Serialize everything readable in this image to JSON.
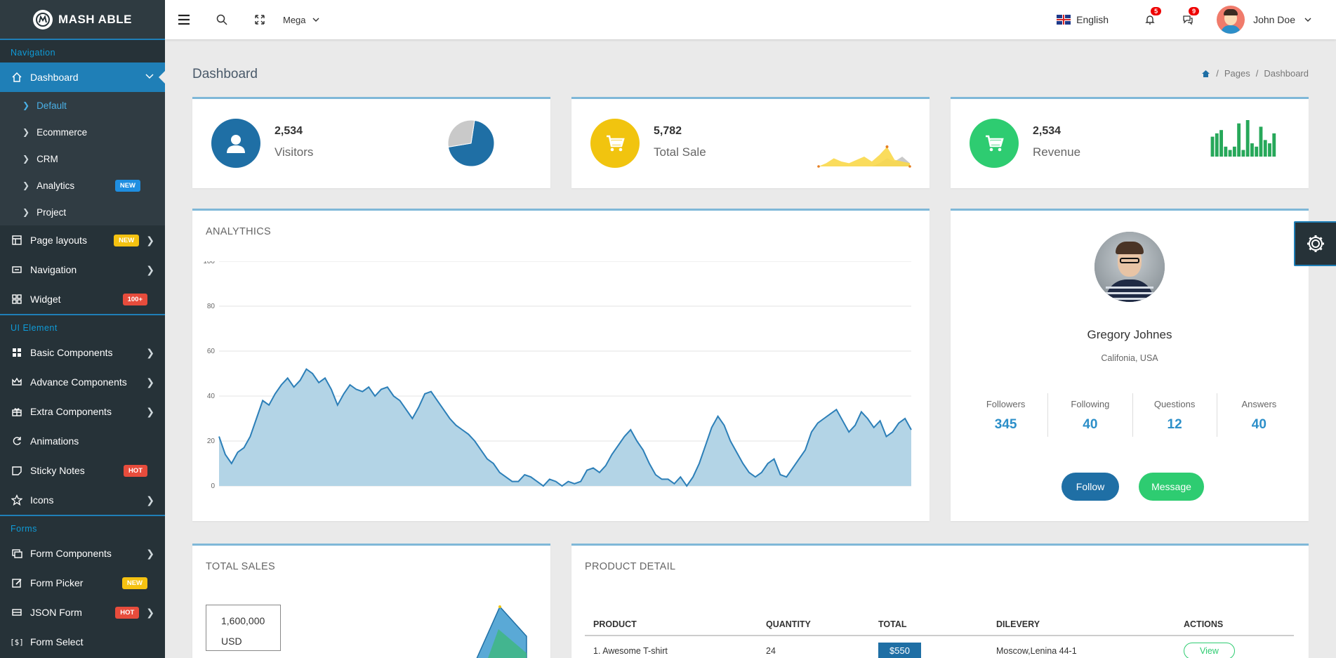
{
  "brand": {
    "name": "MASH ABLE"
  },
  "sidebar": {
    "captions": {
      "navigation": "Navigation",
      "ui": "UI Element",
      "forms": "Forms"
    },
    "dashboard": {
      "label": "Dashboard",
      "children": [
        "Default",
        "Ecommerce",
        "CRM",
        "Analytics",
        "Project"
      ],
      "analytics_badge": "NEW"
    },
    "items_nav": [
      {
        "label": "Page layouts",
        "badge": "NEW",
        "badge_color": "yellow",
        "icon": "layout-icon"
      },
      {
        "label": "Navigation",
        "badge": "",
        "icon": "navigation-icon"
      },
      {
        "label": "Widget",
        "badge": "100+",
        "badge_color": "red",
        "icon": "widget-icon"
      }
    ],
    "items_ui": [
      {
        "label": "Basic Components",
        "icon": "grid-icon"
      },
      {
        "label": "Advance Components",
        "icon": "crown-icon"
      },
      {
        "label": "Extra Components",
        "icon": "gift-icon"
      },
      {
        "label": "Animations",
        "icon": "refresh-icon"
      },
      {
        "label": "Sticky Notes",
        "badge": "HOT",
        "icon": "sticky-note-icon"
      },
      {
        "label": "Icons",
        "icon": "star-icon"
      }
    ],
    "items_forms": [
      {
        "label": "Form Components",
        "icon": "form-icon"
      },
      {
        "label": "Form Picker",
        "badge": "NEW",
        "icon": "edit-icon"
      },
      {
        "label": "JSON Form",
        "badge": "HOT",
        "icon": "json-icon"
      },
      {
        "label": "Form Select",
        "icon": "select-icon"
      }
    ]
  },
  "header": {
    "mega_label": "Mega",
    "language": "English",
    "notif_count": "5",
    "chat_count": "9",
    "user_name": "John Doe"
  },
  "page": {
    "title": "Dashboard",
    "breadcrumb": [
      "Pages",
      "Dashboard"
    ]
  },
  "stats": [
    {
      "value": "2,534",
      "label": "Visitors",
      "color": "#1f6fa5"
    },
    {
      "value": "5,782",
      "label": "Total Sale",
      "color": "#f1c40f"
    },
    {
      "value": "2,534",
      "label": "Revenue",
      "color": "#2ecc71"
    }
  ],
  "analytics": {
    "title": "ANALYTHICS"
  },
  "chart_data": {
    "type": "area",
    "title": "ANALYTHICS",
    "ylim": [
      0,
      100
    ],
    "yticks": [
      0,
      20,
      40,
      60,
      80,
      100
    ],
    "grid": true,
    "color": "#2c7fb8",
    "values": [
      22,
      14,
      10,
      15,
      17,
      22,
      30,
      38,
      36,
      41,
      45,
      48,
      44,
      47,
      52,
      50,
      46,
      48,
      43,
      36,
      41,
      45,
      43,
      42,
      44,
      40,
      43,
      44,
      40,
      38,
      34,
      30,
      35,
      41,
      42,
      38,
      34,
      30,
      27,
      25,
      23,
      20,
      16,
      12,
      10,
      6,
      4,
      2,
      2,
      5,
      4,
      2,
      0,
      3,
      2,
      0,
      2,
      1,
      2,
      7,
      8,
      6,
      9,
      14,
      18,
      22,
      25,
      20,
      16,
      10,
      5,
      3,
      3,
      1,
      4,
      0,
      4,
      10,
      18,
      26,
      31,
      27,
      20,
      15,
      10,
      6,
      4,
      6,
      10,
      12,
      5,
      4,
      8,
      12,
      16,
      24,
      28,
      30,
      32,
      34,
      29,
      24,
      27,
      33,
      30,
      26,
      29,
      22,
      24,
      28,
      30,
      25
    ]
  },
  "sparklines": {
    "visitors_pie": [
      70,
      30
    ],
    "sales_area": [
      [
        0,
        2,
        5,
        3,
        2,
        4,
        6,
        3,
        7,
        12,
        4,
        3,
        2
      ],
      [
        0,
        0,
        0,
        0,
        0,
        0,
        0,
        0,
        2,
        5,
        3,
        6,
        2
      ]
    ],
    "revenue_bars": [
      6,
      7,
      8,
      3,
      2,
      3,
      10,
      2,
      11,
      4,
      3,
      9,
      5,
      4,
      7
    ]
  },
  "profile": {
    "name": "Gregory Johnes",
    "location": "Califonia, USA",
    "stats": [
      {
        "label": "Followers",
        "value": "345"
      },
      {
        "label": "Following",
        "value": "40"
      },
      {
        "label": "Questions",
        "value": "12"
      },
      {
        "label": "Answers",
        "value": "40"
      }
    ],
    "follow_label": "Follow",
    "message_label": "Message"
  },
  "total_sales": {
    "title": "TOTAL SALES",
    "amount": "1,600,000",
    "currency": "USD"
  },
  "product": {
    "title": "PRODUCT DETAIL",
    "columns": [
      "PRODUCT",
      "QUANTITY",
      "TOTAL",
      "DILEVERY",
      "ACTIONS"
    ],
    "rows": [
      {
        "product": "1. Awesome T-shirt",
        "quantity": "24",
        "total": "$550",
        "delivery": "Moscow,Lenina 44-1",
        "action": "View"
      }
    ]
  }
}
